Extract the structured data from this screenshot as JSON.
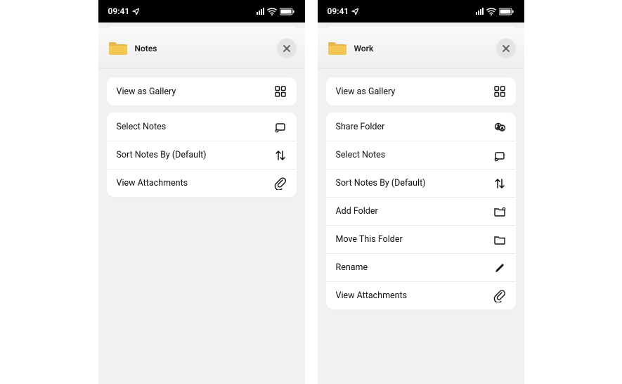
{
  "status": {
    "time": "09:41"
  },
  "phones": [
    {
      "title": "Notes",
      "groups": [
        [
          {
            "label": "View as Gallery",
            "icon": "grid"
          }
        ],
        [
          {
            "label": "Select Notes",
            "icon": "select"
          },
          {
            "label": "Sort Notes By (Default)",
            "icon": "sort"
          },
          {
            "label": "View Attachments",
            "icon": "attach"
          }
        ]
      ]
    },
    {
      "title": "Work",
      "groups": [
        [
          {
            "label": "View as Gallery",
            "icon": "grid"
          }
        ],
        [
          {
            "label": "Share Folder",
            "icon": "share"
          },
          {
            "label": "Select Notes",
            "icon": "select"
          },
          {
            "label": "Sort Notes By (Default)",
            "icon": "sort"
          },
          {
            "label": "Add Folder",
            "icon": "addfolder"
          },
          {
            "label": "Move This Folder",
            "icon": "folder"
          },
          {
            "label": "Rename",
            "icon": "pencil"
          },
          {
            "label": "View Attachments",
            "icon": "attach"
          }
        ]
      ]
    }
  ]
}
